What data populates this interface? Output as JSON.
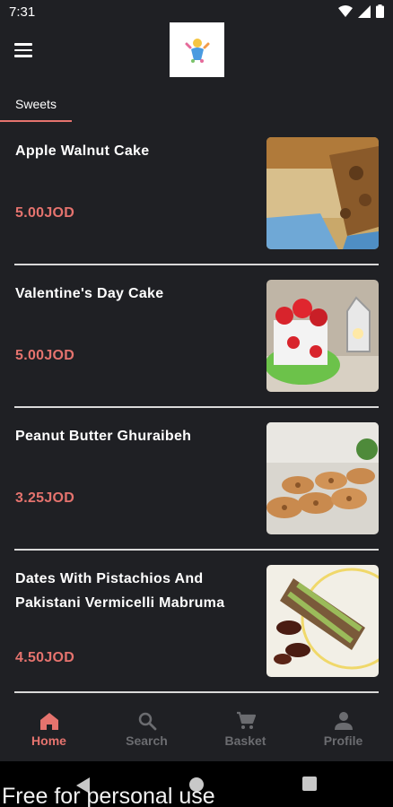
{
  "status_bar": {
    "time": "7:31",
    "icons": [
      "wifi-icon",
      "signal-icon",
      "battery-icon"
    ]
  },
  "app_bar": {
    "menu_icon": "hamburger-menu-icon",
    "logo": "sweets-logo"
  },
  "tabs": [
    {
      "label": "Sweets",
      "active": true
    }
  ],
  "items": [
    {
      "name": "Apple Walnut Cake",
      "price": "5.00JOD",
      "image": "apple-walnut-cake-photo"
    },
    {
      "name": "Valentine's Day Cake",
      "price": "5.00JOD",
      "image": "valentines-day-cake-photo"
    },
    {
      "name": "Peanut Butter Ghuraibeh",
      "price": "3.25JOD",
      "image": "peanut-butter-ghuraibeh-photo"
    },
    {
      "name": "Dates With Pistachios And Pakistani Vermicelli Mabruma",
      "price": "4.50JOD",
      "image": "dates-pistachio-mabruma-photo"
    }
  ],
  "bottom_nav": [
    {
      "label": "Home",
      "icon": "home-icon",
      "active": true
    },
    {
      "label": "Search",
      "icon": "search-icon",
      "active": false
    },
    {
      "label": "Basket",
      "icon": "cart-icon",
      "active": false
    },
    {
      "label": "Profile",
      "icon": "profile-icon",
      "active": false
    }
  ],
  "watermark": "Free for personal use",
  "colors": {
    "background": "#1f2024",
    "accent": "#e5736e",
    "inactive": "#6b6c70"
  }
}
